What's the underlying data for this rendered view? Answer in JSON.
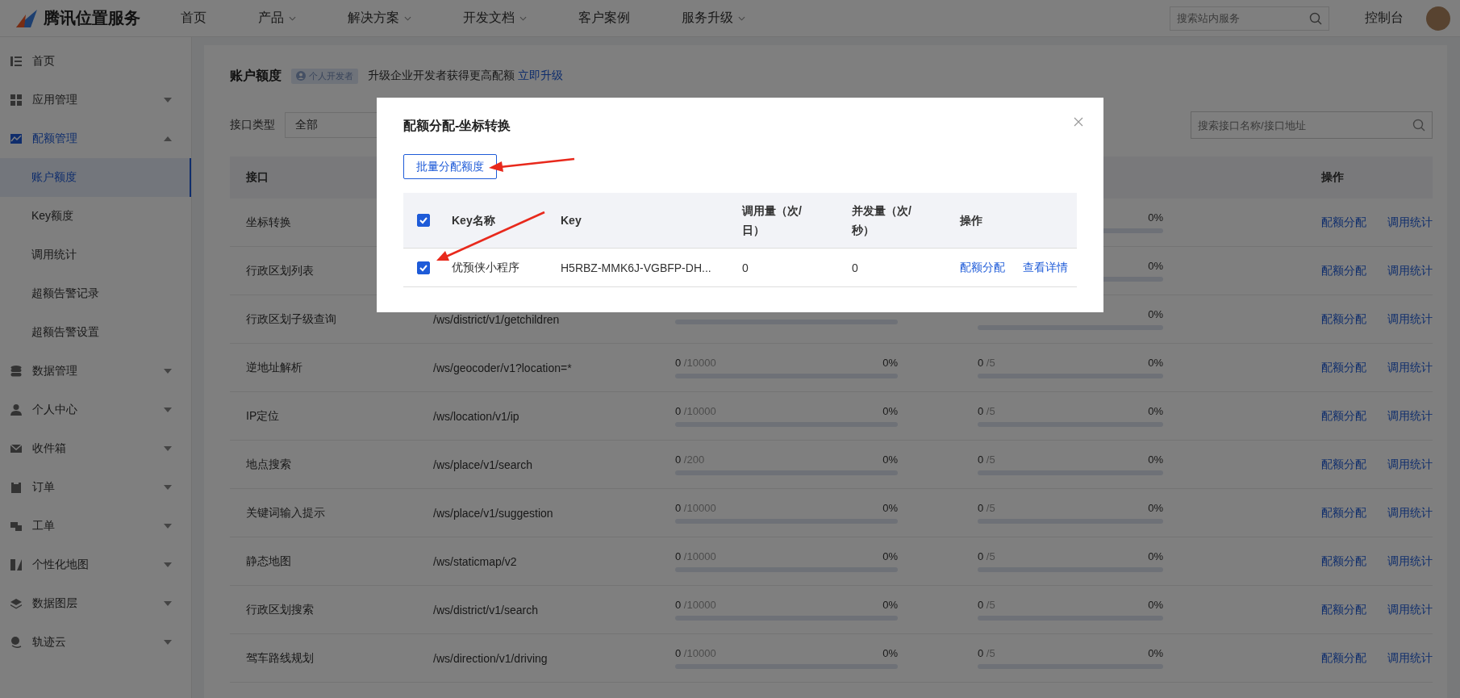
{
  "header": {
    "logo": "腾讯位置服务",
    "nav": [
      {
        "label": "首页",
        "dropdown": false
      },
      {
        "label": "产品",
        "dropdown": true
      },
      {
        "label": "解决方案",
        "dropdown": true
      },
      {
        "label": "开发文档",
        "dropdown": true
      },
      {
        "label": "客户案例",
        "dropdown": false
      },
      {
        "label": "服务升级",
        "dropdown": true
      }
    ],
    "search": {
      "placeholder": "搜索站内服务"
    },
    "console": "控制台"
  },
  "sidebar": {
    "items": [
      {
        "label": "首页",
        "active": false,
        "expandable": false,
        "expanded": false
      },
      {
        "label": "应用管理",
        "active": false,
        "expandable": true,
        "expanded": false
      },
      {
        "label": "配额管理",
        "active": true,
        "expandable": true,
        "expanded": true,
        "children": [
          {
            "label": "账户额度",
            "selected": true
          },
          {
            "label": "Key额度",
            "selected": false
          },
          {
            "label": "调用统计",
            "selected": false
          },
          {
            "label": "超额告警记录",
            "selected": false
          },
          {
            "label": "超额告警设置",
            "selected": false
          }
        ]
      },
      {
        "label": "数据管理",
        "active": false,
        "expandable": true,
        "expanded": false
      },
      {
        "label": "个人中心",
        "active": false,
        "expandable": true,
        "expanded": false
      },
      {
        "label": "收件箱",
        "active": false,
        "expandable": true,
        "expanded": false
      },
      {
        "label": "订单",
        "active": false,
        "expandable": true,
        "expanded": false
      },
      {
        "label": "工单",
        "active": false,
        "expandable": true,
        "expanded": false
      },
      {
        "label": "个性化地图",
        "active": false,
        "expandable": true,
        "expanded": false
      },
      {
        "label": "数据图层",
        "active": false,
        "expandable": true,
        "expanded": false
      },
      {
        "label": "轨迹云",
        "active": false,
        "expandable": true,
        "expanded": false
      }
    ]
  },
  "content": {
    "title": "账户额度",
    "badge": "个人开发者",
    "upgrade_note": "升级企业开发者获得更高配额",
    "upgrade_link": "立即升级",
    "filter": {
      "label": "接口类型",
      "value": "全部"
    },
    "search": {
      "placeholder": "搜索接口名称/接口地址"
    },
    "table": {
      "columns": [
        "接口",
        "操作"
      ],
      "rows": [
        {
          "name": "坐标转换",
          "concurrency": {
            "percent": "0%",
            "level": 0
          },
          "actions": [
            "配额分配",
            "调用统计"
          ]
        },
        {
          "name": "行政区划列表",
          "concurrency": {
            "percent": "0%",
            "level": 0
          },
          "actions": [
            "配额分配",
            "调用统计"
          ]
        },
        {
          "name": "行政区划子级查询",
          "path": "/ws/district/v1/getchildren",
          "calls": {
            "level": 0
          },
          "concurrency": {
            "percent": "0%",
            "level": 0
          },
          "actions": [
            "配额分配",
            "调用统计"
          ]
        },
        {
          "name": "逆地址解析",
          "path": "/ws/geocoder/v1?location=*",
          "calls": {
            "used": "0",
            "quota": "/10000",
            "percent": "0%",
            "level": 0
          },
          "concurrency": {
            "used": "0",
            "quota": "/5",
            "percent": "0%",
            "level": 0
          },
          "actions": [
            "配额分配",
            "调用统计"
          ]
        },
        {
          "name": "IP定位",
          "path": "/ws/location/v1/ip",
          "calls": {
            "used": "0",
            "quota": "/10000",
            "percent": "0%",
            "level": 0
          },
          "concurrency": {
            "used": "0",
            "quota": "/5",
            "percent": "0%",
            "level": 0
          },
          "actions": [
            "配额分配",
            "调用统计"
          ]
        },
        {
          "name": "地点搜索",
          "path": "/ws/place/v1/search",
          "calls": {
            "used": "0",
            "quota": "/200",
            "percent": "0%",
            "level": 0
          },
          "concurrency": {
            "used": "0",
            "quota": "/5",
            "percent": "0%",
            "level": 0
          },
          "actions": [
            "配额分配",
            "调用统计"
          ]
        },
        {
          "name": "关键词输入提示",
          "path": "/ws/place/v1/suggestion",
          "calls": {
            "used": "0",
            "quota": "/10000",
            "percent": "0%",
            "level": 0
          },
          "concurrency": {
            "used": "0",
            "quota": "/5",
            "percent": "0%",
            "level": 0
          },
          "actions": [
            "配额分配",
            "调用统计"
          ]
        },
        {
          "name": "静态地图",
          "path": "/ws/staticmap/v2",
          "calls": {
            "used": "0",
            "quota": "/10000",
            "percent": "0%",
            "level": 0
          },
          "concurrency": {
            "used": "0",
            "quota": "/5",
            "percent": "0%",
            "level": 0
          },
          "actions": [
            "配额分配",
            "调用统计"
          ]
        },
        {
          "name": "行政区划搜索",
          "path": "/ws/district/v1/search",
          "calls": {
            "used": "0",
            "quota": "/10000",
            "percent": "0%",
            "level": 0
          },
          "concurrency": {
            "used": "0",
            "quota": "/5",
            "percent": "0%",
            "level": 0
          },
          "actions": [
            "配额分配",
            "调用统计"
          ]
        },
        {
          "name": "驾车路线规划",
          "path": "/ws/direction/v1/driving",
          "calls": {
            "used": "0",
            "quota": "/10000",
            "percent": "0%",
            "level": 0
          },
          "concurrency": {
            "used": "0",
            "quota": "/5",
            "percent": "0%",
            "level": 0
          },
          "actions": [
            "配额分配",
            "调用统计"
          ]
        }
      ]
    }
  },
  "modal": {
    "title": "配额分配-坐标转换",
    "batch_button": "批量分配额度",
    "header_checked": true,
    "columns": [
      "Key名称",
      "Key",
      "调用量（次/日）",
      "并发量（次/秒）",
      "操作"
    ],
    "rows": [
      {
        "checked": true,
        "name": "优预侠小程序",
        "key": "H5RBZ-MMK6J-VGBFP-DH...",
        "calls": "0",
        "concurrency": "0",
        "actions": [
          "配额分配",
          "查看详情"
        ]
      }
    ]
  }
}
